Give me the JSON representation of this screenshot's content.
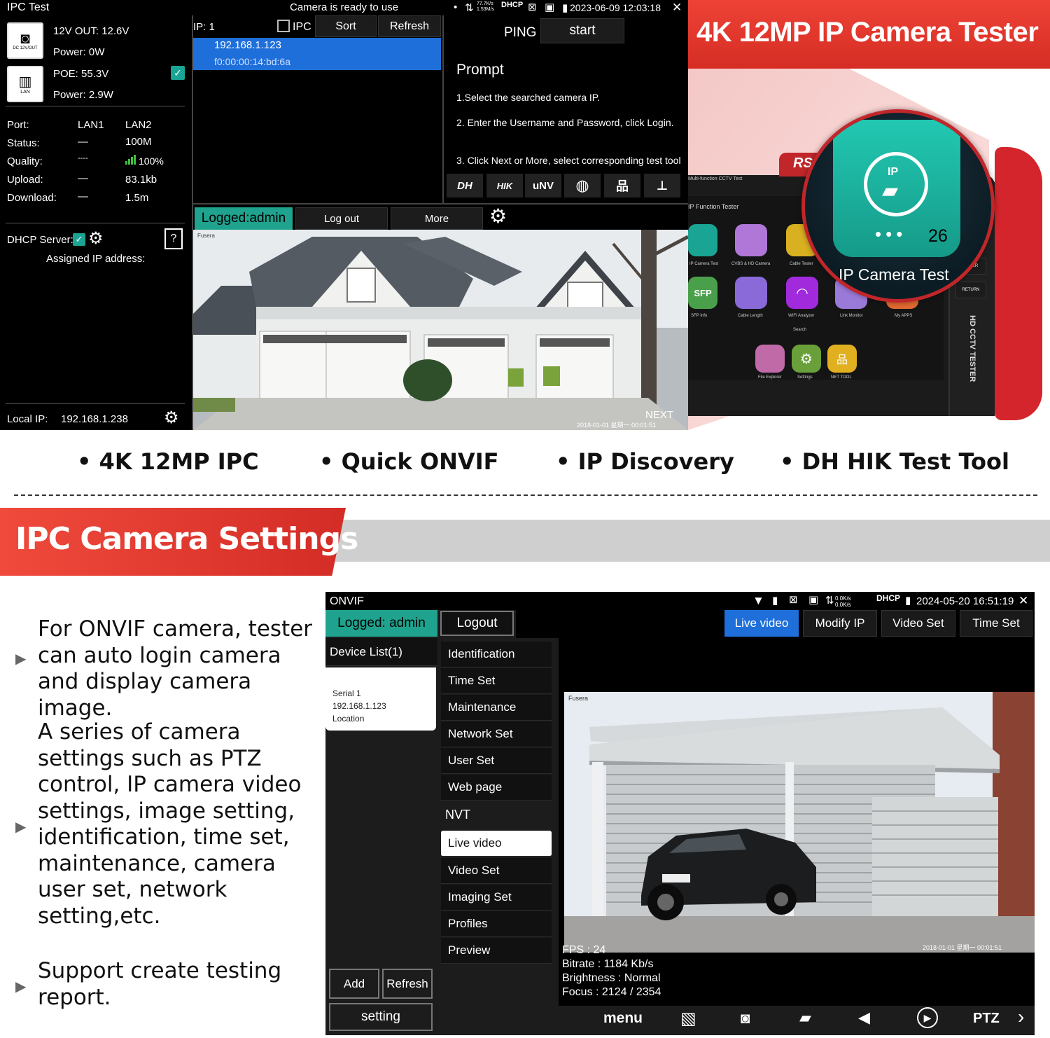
{
  "top_screen": {
    "status": {
      "app_title": "IPC Test",
      "message": "Camera is ready to use",
      "net_rate": "77.7K/s\n1.53M/s",
      "dhcp": "DHCP",
      "datetime": "2023-06-09 12:03:18"
    },
    "power": {
      "dc_label": "DC 12V/OUT",
      "out": "12V OUT: 12.6V",
      "power1": "Power: 0W",
      "lan_label": "LAN",
      "poe": "POE: 55.3V",
      "power2": "Power: 2.9W"
    },
    "ports": {
      "port_label": "Port:",
      "lan1": "LAN1",
      "lan2": "LAN2",
      "status_label": "Status:",
      "status1": "—",
      "status2": "100M",
      "quality_label": "Quality:",
      "quality1": "----",
      "quality2": "100%",
      "upload_label": "Upload:",
      "upload1": "—",
      "upload2": "83.1kb",
      "download_label": "Download:",
      "download1": "—",
      "download2": "1.5m"
    },
    "dhcp_server": "DHCP Server:",
    "assigned_ip": "Assigned IP address:",
    "local_ip_label": "Local IP:",
    "local_ip": "192.168.1.238",
    "ip_list": {
      "ip_count": "IP: 1",
      "ipc": "IPC",
      "sort": "Sort",
      "refresh": "Refresh",
      "selected_ip": "192.168.1.123",
      "selected_mac": "f0:00:00:14:bd:6a"
    },
    "ping": {
      "label": "PING",
      "start": "start",
      "prompt_title": "Prompt",
      "step1": "1.Select the searched camera IP.",
      "step2": "2. Enter the Username and Password, click Login.",
      "step3": "3. Click Next or More, select corresponding test tool"
    },
    "brands": [
      "DH",
      "HIK",
      "uNV"
    ],
    "login_bar": {
      "logged": "Logged:admin",
      "logout": "Log out",
      "more": "More"
    },
    "video": {
      "brand_mark": "Fusera",
      "next": "NEXT",
      "timestamp": "2018-01-01 星期一 00:01:51"
    }
  },
  "promo_top": {
    "title": "4K 12MP IP Camera Tester",
    "device_strip": "Multi-function CCTV Test",
    "device_sub": "IP Function Tester",
    "device_brand": "RS",
    "hd_label": "HD CCTV TESTER",
    "enter": "ENTER",
    "return": "RETURN",
    "search": "Search",
    "zoom_icon_count": "26",
    "zoom_icon_label": "IP Camera Test",
    "ip_glyph": "IP",
    "apps": [
      {
        "label": "IP Camera Test",
        "color": "#1aa493"
      },
      {
        "label": "CVBS & HD Camera",
        "color": "#b076d8"
      },
      {
        "label": "Cable Tester",
        "color": "#d8b020"
      },
      {
        "label": "SFP Info",
        "color": "#4aa04a"
      },
      {
        "label": "Cable Length",
        "color": "#8a6ad8"
      },
      {
        "label": "WIFI Analyzer",
        "color": "#a02adc"
      },
      {
        "label": "Link Monitor",
        "color": "#9a7ad8"
      },
      {
        "label": "My APPS",
        "color": "#e06a30"
      },
      {
        "label": "File Explorer",
        "color": "#c06aa8"
      },
      {
        "label": "Settings",
        "color": "#6aa03a"
      },
      {
        "label": "NET TOOL",
        "color": "#e0b020"
      }
    ]
  },
  "features": [
    "4K 12MP IPC",
    "Quick ONVIF",
    "IP Discovery",
    "DH HIK  Test Tool"
  ],
  "section": {
    "title": "IPC Camera Settings",
    "text1": "For ONVIF camera, tester can auto login camera and display camera image.",
    "text2": "A series of camera settings such as PTZ control, IP camera video settings, image setting, identification, time set, maintenance, camera user set, network setting,etc.",
    "text3": "Support create testing report."
  },
  "bottom_screen": {
    "status": {
      "app_title": "ONVIF",
      "net_rate": "0.0K/s\n0.0K/s",
      "dhcp": "DHCP",
      "datetime": "2024-05-20 16:51:19"
    },
    "logged": "Logged:  admin",
    "logout": "Logout",
    "tabs": [
      "Live video",
      "Modify IP",
      "Video Set",
      "Time Set"
    ],
    "device_list": "Device List(1)",
    "device": {
      "serial": "Serial 1",
      "ip": "192.168.1.123",
      "location": "Location"
    },
    "menu": [
      "Identification",
      "Time Set",
      "Maintenance",
      "Network Set",
      "User Set",
      "Web page"
    ],
    "nvt": "NVT",
    "nvt_menu": [
      "Live video",
      "Video Set",
      "Imaging Set",
      "Profiles",
      "Preview"
    ],
    "add": "Add",
    "refresh": "Refresh",
    "setting": "setting",
    "video": {
      "brand_mark": "Fusera",
      "timestamp": "2018-01-01 星期一 00:01:51",
      "fps": "FPS : 24",
      "bitrate": "Bitrate : 1184 Kb/s",
      "brightness": "Brightness : Normal",
      "focus": "Focus : 2124 / 2354"
    },
    "toolbar": {
      "menu": "menu",
      "ptz": "PTZ"
    }
  },
  "colors": {
    "accent_red": "#e53935",
    "selection_blue": "#1e6fd9",
    "logged_green": "#1fa38e",
    "check_teal": "#1aa493"
  }
}
